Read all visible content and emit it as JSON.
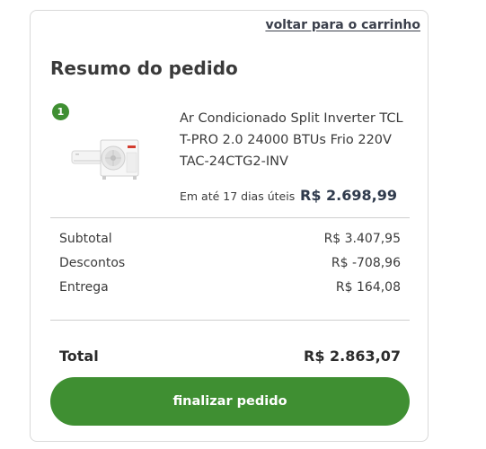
{
  "header": {
    "back_link": "voltar para o carrinho",
    "title": "Resumo do pedido"
  },
  "item": {
    "quantity": "1",
    "name": "Ar Condicionado Split Inverter TCL T-PRO 2.0 24000 BTUs Frio 220V TAC-24CTG2-INV",
    "delivery": "Em até 17 dias úteis",
    "price": "R$ 2.698,99",
    "image": "air-conditioner-product-photo"
  },
  "summary": {
    "subtotal_label": "Subtotal",
    "subtotal_value": "R$ 3.407,95",
    "discount_label": "Descontos",
    "discount_value": "R$ -708,96",
    "shipping_label": "Entrega",
    "shipping_value": "R$ 164,08",
    "total_label": "Total",
    "total_value": "R$ 2.863,07"
  },
  "actions": {
    "checkout_label": "finalizar pedido"
  },
  "colors": {
    "accent": "#3f8f32",
    "price_text": "#2f3a4c",
    "border": "#d9d9d9"
  }
}
